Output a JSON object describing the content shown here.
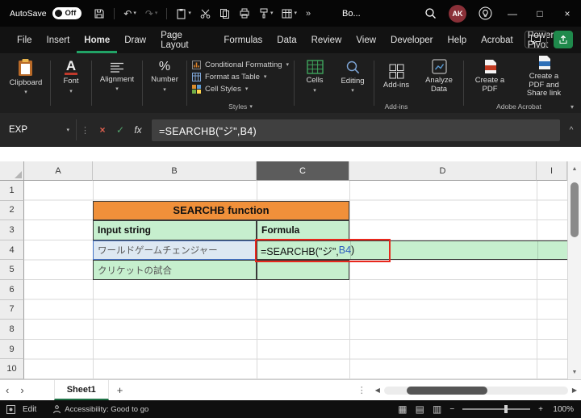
{
  "titlebar": {
    "autosave_label": "AutoSave",
    "autosave_state": "Off",
    "doc_name": "Bo...",
    "avatar": "AK"
  },
  "menubar": {
    "tabs": [
      "File",
      "Insert",
      "Home",
      "Draw",
      "Page Layout",
      "Formulas",
      "Data",
      "Review",
      "View",
      "Developer",
      "Help",
      "Acrobat",
      "Power Pivot"
    ]
  },
  "ribbon": {
    "clipboard_label": "Clipboard",
    "font_label": "Font",
    "alignment_label": "Alignment",
    "number_label": "Number",
    "conditional_formatting_label": "Conditional Formatting",
    "format_as_table_label": "Format as Table",
    "cell_styles_label": "Cell Styles",
    "styles_group_label": "Styles",
    "cells_label": "Cells",
    "editing_label": "Editing",
    "addins_label": "Add-ins",
    "addins_group_label": "Add-ins",
    "analyze_data_label": "Analyze Data",
    "create_pdf_label": "Create a PDF",
    "create_pdf_share_label": "Create a PDF and Share link",
    "acrobat_group_label": "Adobe Acrobat"
  },
  "formula_bar": {
    "name_box_value": "EXP",
    "fx_label": "fx",
    "formula": "=SEARCHB(\"ジ\",B4)"
  },
  "sheet": {
    "columns": [
      "A",
      "B",
      "C",
      "D",
      "I"
    ],
    "selected_column": "C",
    "rows": [
      "1",
      "2",
      "3",
      "4",
      "5",
      "6",
      "7",
      "8",
      "9",
      "10"
    ],
    "cells": {
      "title": "SEARCHB function",
      "input_header": "Input string",
      "formula_header": "Formula",
      "b4": "ワールドゲームチェンジャー",
      "b5": "クリケットの試合",
      "c4_formula_prefix": "=SEARCHB(\"ジ\",",
      "c4_formula_ref": "B4",
      "c4_formula_close": ")"
    }
  },
  "tabbar": {
    "sheet_name": "Sheet1"
  },
  "statusbar": {
    "mode": "Edit",
    "accessibility": "Accessibility: Good to go",
    "zoom": "100%"
  },
  "glyphs": {
    "caret_down": "▾",
    "overflow": "»",
    "undo": "↶",
    "redo": "↷",
    "minimize": "—",
    "maximize": "□",
    "close": "×",
    "cancel": "×",
    "enter": "✓",
    "collapse": "^",
    "dots_v": "⋮",
    "prev": "‹",
    "next": "›",
    "add": "+",
    "scroll_left": "◀",
    "scroll_right": "▶",
    "scroll_up": "▲",
    "scroll_down": "▼",
    "minus": "−",
    "plus": "+",
    "view_normal": "▦",
    "view_layout": "▤",
    "view_break": "▥",
    "percent_icon": "%",
    "font_icon": "A"
  },
  "colors": {
    "excel_green": "#21A366",
    "header_orange": "#F0903A",
    "cell_green": "#C6EFCE",
    "ref_blue_fill": "#DDE8F2",
    "ref_blue_border": "#4472C4",
    "formula_ref_text": "#2F5FBF",
    "annotation_red": "#E8271C"
  }
}
